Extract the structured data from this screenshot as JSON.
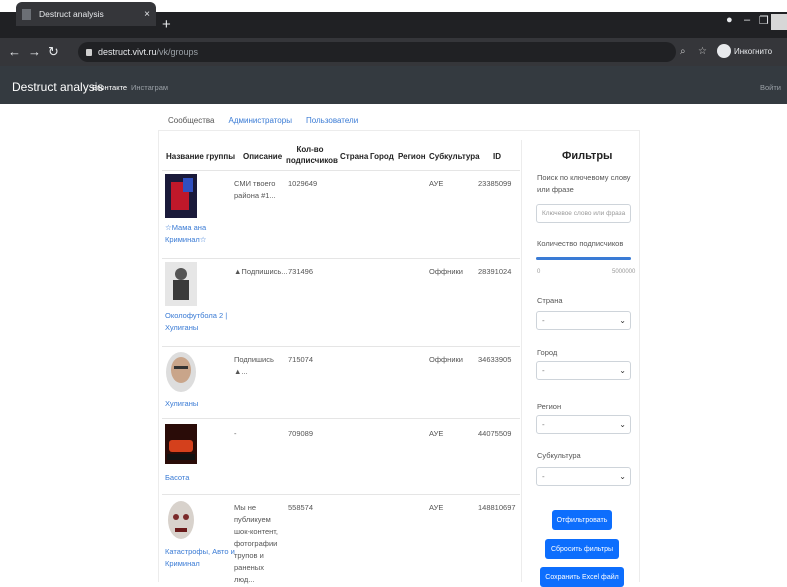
{
  "browser": {
    "tab_title": "Destruct analysis",
    "tab_close": "×",
    "new_tab": "+",
    "url_host": "destruct.vivt.ru",
    "url_path": "/vk/groups",
    "profile_label": "Инкогнито"
  },
  "app": {
    "brand": "Destruct analysis",
    "nav": [
      {
        "label": "Вконтакте"
      },
      {
        "label": "Инстаграм"
      }
    ],
    "login": "Войти"
  },
  "subtabs": [
    "Сообщества",
    "Администраторы",
    "Пользователи"
  ],
  "table": {
    "headers": {
      "name": "Название группы",
      "desc": "Описание",
      "subs": "Кол-во подписчиков",
      "country": "Страна",
      "city": "Город",
      "region": "Регион",
      "subculture": "Субкультура",
      "id": "ID"
    },
    "rows": [
      {
        "name": "☆Мама ана Криминал☆",
        "desc": "СМИ твоего района #1...",
        "subs": "1029649",
        "subculture": "АУЕ",
        "id": "23385099"
      },
      {
        "name": "Околофутбола 2 | Хулиганы",
        "desc": "▲Подпишись...",
        "subs": "731496",
        "subculture": "Оффники",
        "id": "28391024"
      },
      {
        "name": "Хулиганы",
        "desc": "Подпишись ▲...",
        "subs": "715074",
        "subculture": "Оффники",
        "id": "34633905"
      },
      {
        "name": "Басота",
        "desc": "-",
        "subs": "709089",
        "subculture": "АУЕ",
        "id": "44075509"
      },
      {
        "name": "Катастрофы, Авто и Криминал",
        "desc": "Мы не публикуем шок-контент, фотографии трупов и раненых люд...",
        "subs": "558574",
        "subculture": "АУЕ",
        "id": "148810697"
      }
    ]
  },
  "filters": {
    "title": "Фильтры",
    "keyword_label": "Поиск по ключевому слову или фразе",
    "keyword_placeholder": "Ключевое слово или фраза",
    "subs_label": "Количество подписчиков",
    "subs_min": "0",
    "subs_max": "5000000",
    "subs_fill": 1.0,
    "country_label": "Страна",
    "city_label": "Город",
    "region_label": "Регион",
    "subculture_label": "Субкультура",
    "select_placeholder": "-",
    "apply": "Отфильтровать",
    "reset": "Сбросить фильтры",
    "export": "Сохранить Excel файл"
  },
  "colors": {
    "accent": "#0d6efd",
    "link": "#3a7bd5",
    "navbar": "#343a40"
  }
}
